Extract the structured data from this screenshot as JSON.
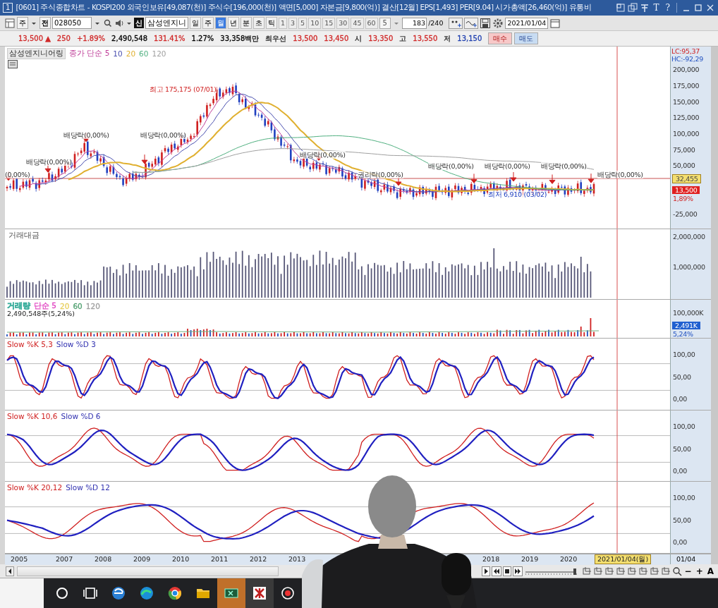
{
  "window": {
    "badge": "1",
    "title": "[0601] 주식종합차트 - KOSPI200 외국인보유[49,087(천)] 주식수[196,000(천)] 액면[5,000] 자본금[9,800(억)] 결산[12월] EPS[1,493] PER[9.04] 시가총액[26,460(억)] 유통비",
    "tools": [
      "T",
      "?"
    ]
  },
  "toolbar": {
    "market": "주",
    "prefix": "전",
    "code": "028050",
    "new_badge": "신",
    "name": "삼성엔지니",
    "periods": [
      {
        "label": "일",
        "selected": false
      },
      {
        "label": "주",
        "selected": false
      },
      {
        "label": "월",
        "selected": true
      },
      {
        "label": "년",
        "selected": false
      },
      {
        "label": "분",
        "selected": false
      },
      {
        "label": "초",
        "selected": false
      },
      {
        "label": "틱",
        "selected": false
      }
    ],
    "intervals": [
      "1",
      "3",
      "5",
      "10",
      "15",
      "30",
      "45",
      "60"
    ],
    "interval_value": "5",
    "count": "183",
    "count_total": "/240",
    "date": "2021/01/04"
  },
  "quote": {
    "items": [
      {
        "text": "13,500 ▲",
        "color": "#d02828"
      },
      {
        "text": "250",
        "color": "#d02828"
      },
      {
        "text": "+1.89%",
        "color": "#d02828"
      },
      {
        "text": "2,490,548",
        "color": "#000000"
      },
      {
        "text": "131.41%",
        "color": "#d02828"
      },
      {
        "text": "1.27%",
        "color": "#000000"
      },
      {
        "text": "33,358백만",
        "color": "#000000"
      },
      {
        "text": "최우선"
      },
      {
        "text": "13,500",
        "color": "#d02828"
      },
      {
        "text": "13,450",
        "color": "#d02828"
      },
      {
        "text": "시"
      },
      {
        "text": "13,350",
        "color": "#d02828"
      },
      {
        "text": "고"
      },
      {
        "text": "13,550",
        "color": "#d02828"
      },
      {
        "text": "저"
      },
      {
        "text": "13,150",
        "color": "#2040b0"
      }
    ],
    "buttons": [
      {
        "label": "매수",
        "kind": "buy"
      },
      {
        "label": "매도",
        "kind": "sell"
      }
    ]
  },
  "price_panel": {
    "name": "삼성엔지니어링",
    "legend": [
      {
        "text": "종가 단순 5",
        "color": "#c0409a"
      },
      {
        "text": "10",
        "color": "#4a50b0"
      },
      {
        "text": "20",
        "color": "#e0b030"
      },
      {
        "text": "60",
        "color": "#50b080"
      },
      {
        "text": "120",
        "color": "#a0a0a0"
      }
    ],
    "annotations": [
      {
        "text": "최고 175,175 (07/01)",
        "kind": "high"
      },
      {
        "text": "배당락(0,00%)",
        "kind": "event"
      },
      {
        "text": "배당락(0,00%)",
        "kind": "event"
      },
      {
        "text": "배당락(0,00%)",
        "kind": "event"
      },
      {
        "text": "배당락(0,00%)",
        "kind": "event"
      },
      {
        "text": "배당락(0,00%)",
        "kind": "event"
      },
      {
        "text": "배당락(0,00%)",
        "kind": "event"
      },
      {
        "text": "배당락(0,00%)",
        "kind": "event"
      },
      {
        "text": "(0,00%)",
        "kind": "event"
      },
      {
        "text": "권리락(0,00%)",
        "kind": "event"
      },
      {
        "text": "배당락(0,00%)",
        "kind": "event"
      },
      {
        "text": "최저 6,910 (03/02)",
        "kind": "low"
      }
    ],
    "axis": {
      "lc": "LC:95,37",
      "hc": "HC:-92,29",
      "ticks": [
        "200,000",
        "175,000",
        "150,000",
        "125,000",
        "100,000",
        "75,000",
        "50,000",
        "-25,000"
      ],
      "current": "32,455",
      "last": "13,500",
      "change": "1,89%"
    }
  },
  "amount_panel": {
    "title": "거래대금",
    "ticks": [
      "2,000,000",
      "1,000,000"
    ]
  },
  "volume_panel": {
    "legend": [
      {
        "text": "거래량",
        "color": "#40b0a0"
      },
      {
        "text": "단순 5",
        "color": "#e040c0"
      },
      {
        "text": "20",
        "color": "#e8d060"
      },
      {
        "text": "60",
        "color": "#50a070"
      },
      {
        "text": "120",
        "color": "#a0a0a0"
      }
    ],
    "info": "2,490,548주(5,24%)",
    "ticks": [
      "100,000K"
    ],
    "last": "2,491K",
    "ratio": "5,24%"
  },
  "stochastics": [
    {
      "k_label": "Slow %K 5,3",
      "d_label": "Slow %D 3",
      "ticks": [
        "100,00",
        "50,00",
        "0,00"
      ]
    },
    {
      "k_label": "Slow %K 10,6",
      "d_label": "Slow %D 6",
      "ticks": [
        "100,00",
        "50,00",
        "0,00"
      ]
    },
    {
      "k_label": "Slow %K 20,12",
      "d_label": "Slow %D 12",
      "ticks": [
        "100,00",
        "50,00",
        "0,00"
      ]
    }
  ],
  "x_axis": {
    "labels": [
      "2005",
      "2007",
      "2008",
      "2009",
      "2010",
      "2011",
      "2012",
      "2013",
      "2018",
      "2019",
      "2020"
    ],
    "cursor": "2021/01/04(월)",
    "end": "01/04"
  },
  "bottom_tools": [
    "−",
    "+",
    "A"
  ]
}
